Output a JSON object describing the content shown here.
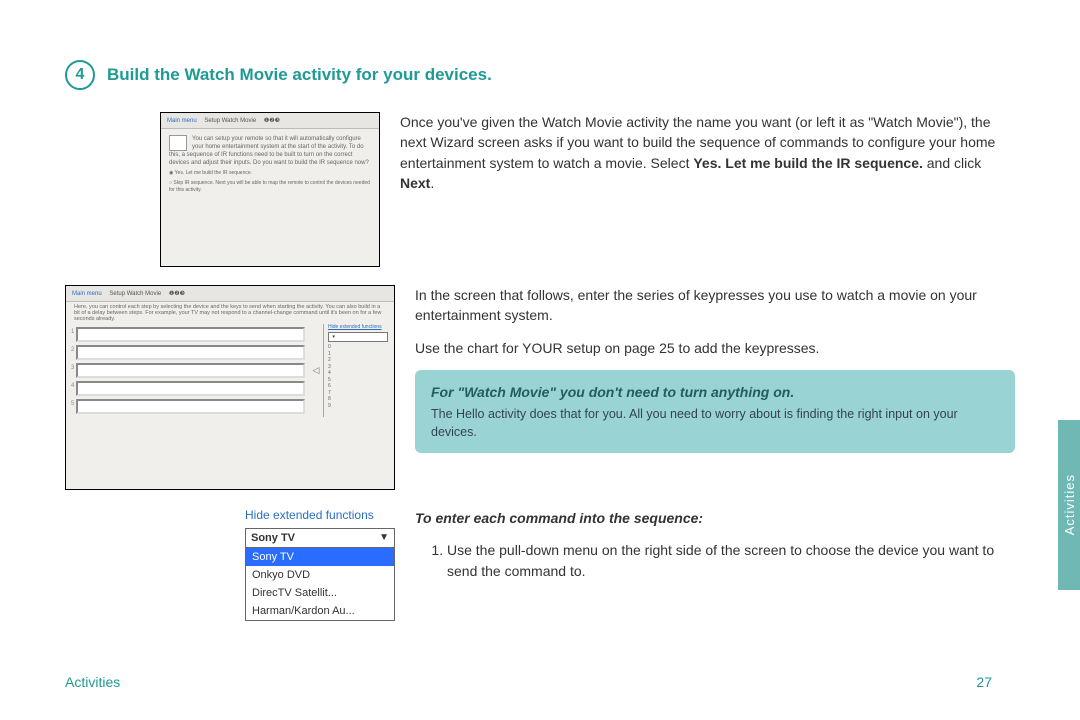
{
  "step": {
    "number": "4",
    "title": "Build the Watch Movie activity for your devices."
  },
  "footer": {
    "section_label": "Activities",
    "page_number": "27"
  },
  "side_tab": {
    "label": "Activities"
  },
  "para1": {
    "pre": "Once you've given the Watch Movie activity the name you want (or left it as \"Watch Movie\"), the next Wizard screen asks if you want to build the sequence of commands to configure your home entertainment system to watch a movie. Select ",
    "bold1": "Yes. Let me build the IR sequence.",
    "mid": " and click ",
    "bold2": "Next",
    "post": "."
  },
  "para2": "In the screen that follows, enter the series of keypresses you use to watch a movie on your entertainment system.",
  "para3": "Use the chart for YOUR setup on page 25 to add the keypresses.",
  "callout": {
    "heading": "For \"Watch Movie\" you don't need to turn anything on.",
    "body": "The Hello activity does that for you. All you need to worry about is finding the right input on your devices."
  },
  "subheading": "To enter each command into the sequence:",
  "list_item_1": "Use the pull-down menu on the right side of the screen to choose the device you want to send the command to.",
  "shot_a": {
    "bc_main": "Main menu",
    "bc_sub": "Setup Watch Movie",
    "body": "You can setup your remote so that it will automatically configure your home entertainment system at the start of the activity. To do this, a sequence of IR functions need to be built to turn on the correct devices and adjust their inputs. Do you want to build the IR sequence now?",
    "opt1": "Yes. Let me build the IR sequence.",
    "opt2": "Skip IR sequence. Next you will be able to map the remote to control the devices needed for this activity."
  },
  "shot_b": {
    "bc_main": "Main menu",
    "bc_sub": "Setup Watch Movie",
    "hint": "Here, you can control each step by selecting the device and the keys to send when starting the activity. You can also build in a bit of a delay between steps. For example, your TV may not respond to a channel-change command until it's been on for a few seconds already.",
    "slots": [
      "1",
      "2",
      "3",
      "4",
      "5"
    ],
    "hide_ext": "Hide extended functions",
    "numlist": [
      "0",
      "1",
      "2",
      "3",
      "4",
      "5",
      "6",
      "7",
      "8",
      "9"
    ]
  },
  "dropdown": {
    "hide_ext": "Hide extended functions",
    "selected": "Sony TV",
    "options": [
      "Sony TV",
      "Onkyo DVD",
      "DirecTV Satellit...",
      "Harman/Kardon Au..."
    ]
  }
}
